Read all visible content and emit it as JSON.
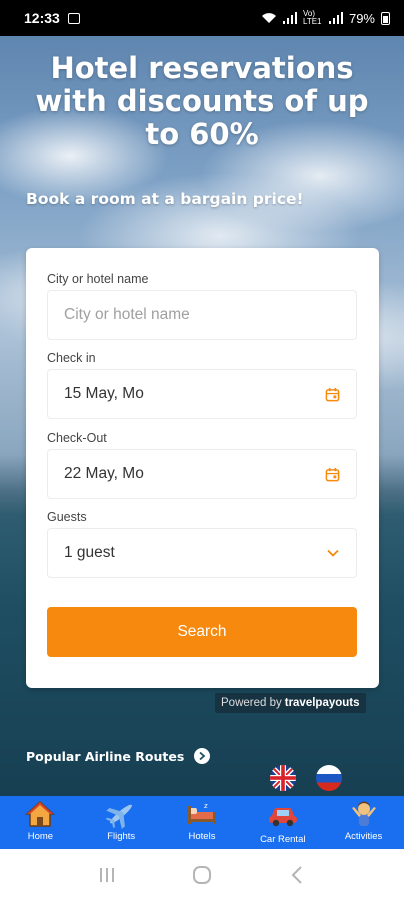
{
  "status_bar": {
    "time": "12:33",
    "network": "Vo) LTE1",
    "battery": "79%"
  },
  "hero": {
    "title": "Hotel reservations with discounts of up to 60%",
    "subtitle": "Book a room at a bargain price!"
  },
  "form": {
    "city_label": "City or hotel name",
    "city_placeholder": "City or hotel name",
    "city_value": "",
    "checkin_label": "Check in",
    "checkin_value": "15 May, Mo",
    "checkout_label": "Check-Out",
    "checkout_value": "22 May, Mo",
    "guests_label": "Guests",
    "guests_value": "1 guest",
    "search_label": "Search"
  },
  "powered_by": {
    "prefix": "Powered by",
    "brand": "travelpayouts"
  },
  "routes_link": "Popular Airline Routes",
  "languages": [
    {
      "name": "uk-flag-icon"
    },
    {
      "name": "ru-flag-icon"
    }
  ],
  "nav": {
    "items": [
      {
        "label": "Home",
        "icon": "home-icon"
      },
      {
        "label": "Flights",
        "icon": "airplane-icon"
      },
      {
        "label": "Hotels",
        "icon": "bed-icon"
      },
      {
        "label": "Car Rental",
        "icon": "car-icon"
      },
      {
        "label": "Activities",
        "icon": "activities-icon"
      }
    ]
  },
  "colors": {
    "accent": "#f7890f",
    "nav_bg": "#1a6ef0",
    "icon_orange": "#f7890f"
  }
}
